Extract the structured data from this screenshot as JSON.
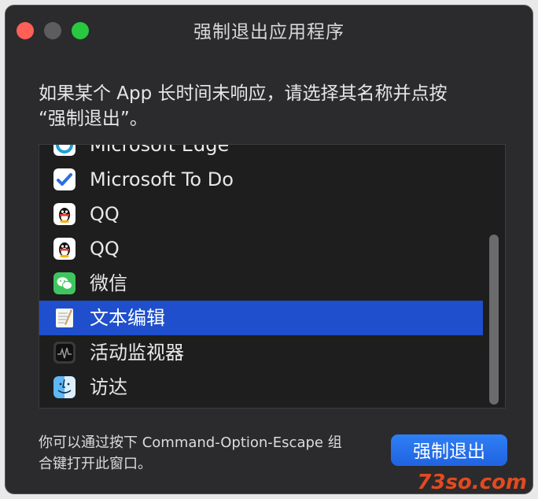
{
  "window": {
    "title": "强制退出应用程序"
  },
  "prompt": {
    "line1": "如果某个 App 长时间未响应，请选择其名称并点按",
    "line2": "“强制退出”。"
  },
  "app_list": {
    "items": [
      {
        "name": "Microsoft Edge",
        "icon": "edge-icon",
        "selected": false
      },
      {
        "name": "Microsoft To Do",
        "icon": "todo-icon",
        "selected": false
      },
      {
        "name": "QQ",
        "icon": "qq-icon",
        "selected": false
      },
      {
        "name": "QQ",
        "icon": "qq-icon",
        "selected": false
      },
      {
        "name": "微信",
        "icon": "wechat-icon",
        "selected": false
      },
      {
        "name": "文本编辑",
        "icon": "textedit-icon",
        "selected": true
      },
      {
        "name": "活动监视器",
        "icon": "activity-monitor-icon",
        "selected": false
      },
      {
        "name": "访达",
        "icon": "finder-icon",
        "selected": false
      }
    ]
  },
  "hint": {
    "line1": "你可以通过按下 Command-Option-Escape 组",
    "line2": "合键打开此窗口。"
  },
  "buttons": {
    "force_quit_label": "强制退出"
  },
  "watermark": "73so.com",
  "colors": {
    "selection": "#1f4fcc",
    "primary_button": "#2f7ff6",
    "window_bg": "#2b2b2d",
    "close": "#fe5f57",
    "zoom": "#28c840"
  }
}
